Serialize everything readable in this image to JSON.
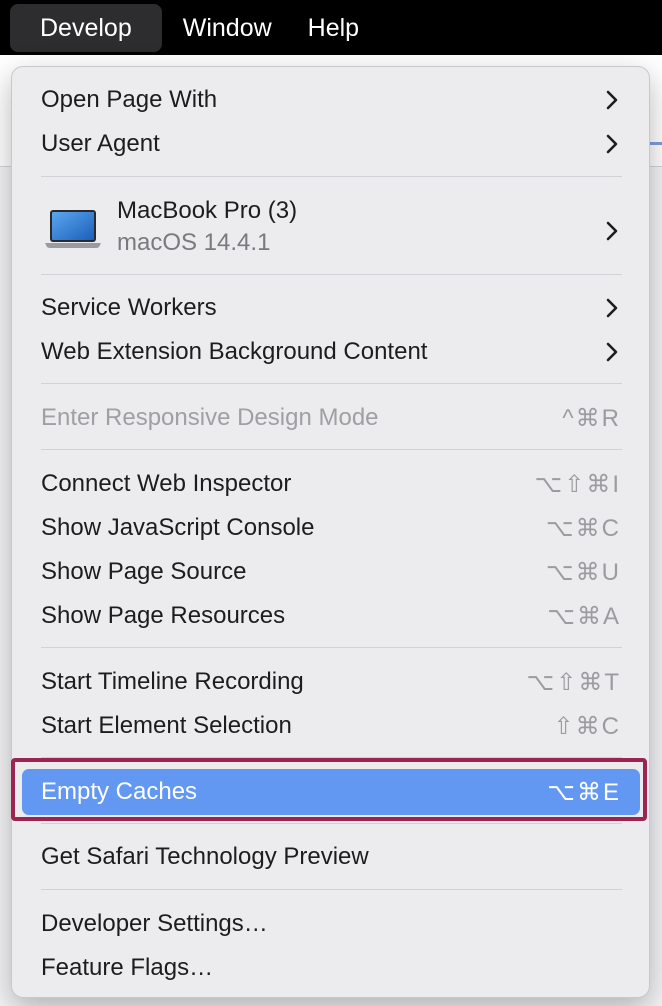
{
  "menubar": {
    "items": [
      {
        "label": "Develop"
      },
      {
        "label": "Window"
      },
      {
        "label": "Help"
      }
    ]
  },
  "menu": {
    "open_page_with": "Open Page With",
    "user_agent": "User Agent",
    "device": {
      "name": "MacBook Pro (3)",
      "os": "macOS 14.4.1",
      "icon": "laptop-icon"
    },
    "service_workers": "Service Workers",
    "web_extension": "Web Extension Background Content",
    "responsive_design": {
      "label": "Enter Responsive Design Mode",
      "shortcut": "^⌘R",
      "enabled": false
    },
    "connect_inspector": {
      "label": "Connect Web Inspector",
      "shortcut": "⌥⇧⌘I"
    },
    "js_console": {
      "label": "Show JavaScript Console",
      "shortcut": "⌥⌘C"
    },
    "page_source": {
      "label": "Show Page Source",
      "shortcut": "⌥⌘U"
    },
    "page_resources": {
      "label": "Show Page Resources",
      "shortcut": "⌥⌘A"
    },
    "timeline": {
      "label": "Start Timeline Recording",
      "shortcut": "⌥⇧⌘T"
    },
    "element_selection": {
      "label": "Start Element Selection",
      "shortcut": "⇧⌘C"
    },
    "empty_caches": {
      "label": "Empty Caches",
      "shortcut": "⌥⌘E",
      "highlighted": true
    },
    "safari_tp": "Get Safari Technology Preview",
    "dev_settings": "Developer Settings…",
    "feature_flags": "Feature Flags…"
  },
  "colors": {
    "highlight": "#6298f1",
    "annotation": "#9b2452",
    "menubar": "#000000"
  }
}
